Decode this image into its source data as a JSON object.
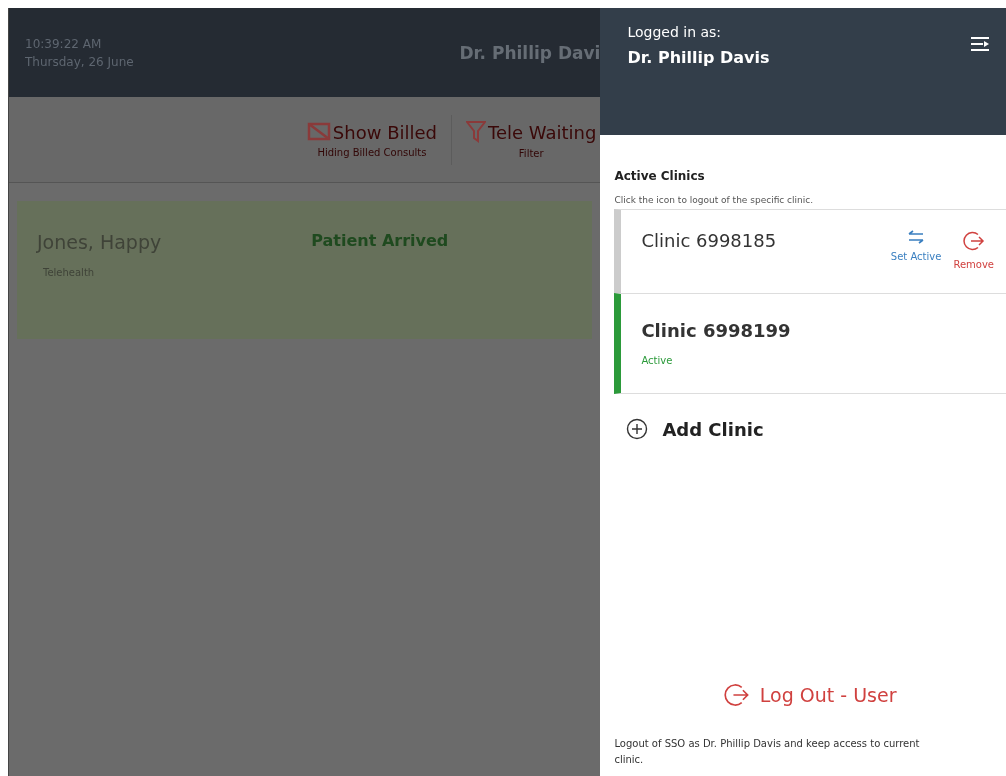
{
  "background_app": {
    "header": {
      "time": "10:39:22 AM",
      "date": "Thursday, 26 June",
      "user": "Dr. Phillip Davi"
    },
    "toolbar": [
      {
        "kind": "billed",
        "label": "Show Billed",
        "caption": "Hiding Billed Consults"
      },
      {
        "kind": "filter",
        "label": "Tele Waiting",
        "caption": "Filter"
      }
    ],
    "patients": [
      {
        "name": "Jones, Happy",
        "type": "Telehealth",
        "status": "Patient Arrived"
      }
    ]
  },
  "drawer": {
    "logged_in_label": "Logged in as:",
    "user": "Dr. Phillip Davis",
    "section_title": "Active Clinics",
    "hint": "Click the icon to logout of the specific clinic.",
    "clinics": [
      {
        "name": "Clinic 6998185",
        "selected": false,
        "actions": [
          {
            "kind": "switch",
            "label": "Set Active"
          },
          {
            "kind": "remove",
            "label": "Remove"
          }
        ]
      },
      {
        "name": "Clinic 6998199",
        "selected": true,
        "status": "Active"
      }
    ],
    "add_button": "Add Clinic",
    "logout_button": "Log Out - User",
    "logout_note": "Logout of SSO as Dr. Phillip Davis and keep access to current clinic."
  }
}
